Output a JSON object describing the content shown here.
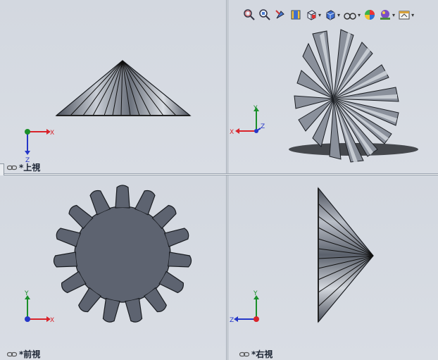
{
  "views": {
    "top": {
      "label": "*上視"
    },
    "front": {
      "label": "*前視"
    },
    "right": {
      "label": "*右視"
    },
    "iso": {
      "label": ""
    }
  },
  "axes": {
    "x": "X",
    "y": "Y",
    "z": "Z"
  },
  "toolbar": {
    "items": [
      "zoom-to-fit-icon",
      "zoom-to-area-icon",
      "previous-view-icon",
      "section-view-icon",
      "view-orientation-icon",
      "display-style-icon",
      "hide-show-items-icon",
      "edit-appearance-icon",
      "apply-scene-icon",
      "view-settings-icon"
    ]
  },
  "colors": {
    "background": "#d6dbe3",
    "axis_x": "#d9232a",
    "axis_y": "#1a8f2a",
    "axis_z": "#2537c8",
    "gear": "#5d6370"
  }
}
